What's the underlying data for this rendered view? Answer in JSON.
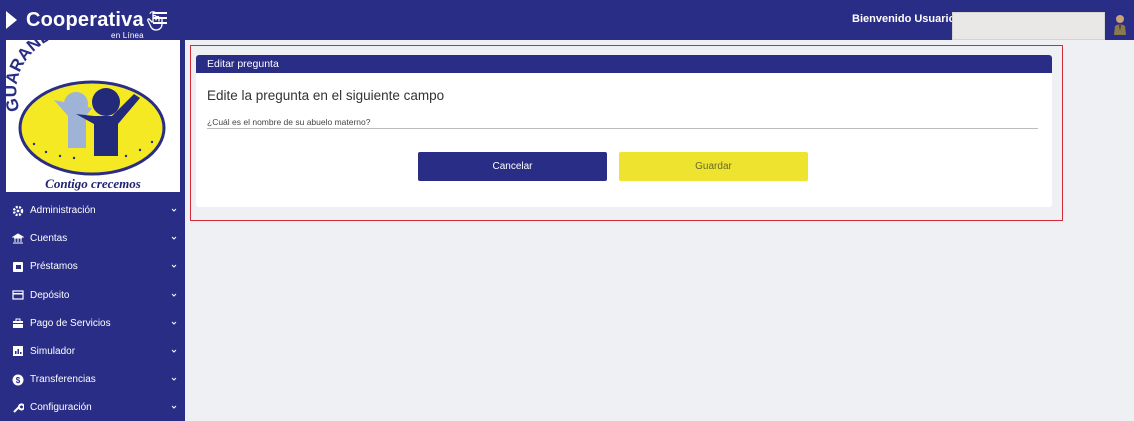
{
  "header": {
    "brand": "Cooperativa",
    "brand_sub": "en Línea",
    "welcome_label": "Bienvenido Usuario:",
    "user_value": ""
  },
  "logo": {
    "name": "GUARANDA Ltda.",
    "slogan": "Contigo crecemos"
  },
  "sidebar": {
    "items": [
      {
        "label": "Administración",
        "icon": "gear-icon"
      },
      {
        "label": "Cuentas",
        "icon": "bank-icon"
      },
      {
        "label": "Préstamos",
        "icon": "wallet-icon"
      },
      {
        "label": "Depósito",
        "icon": "card-icon"
      },
      {
        "label": "Pago de Servicios",
        "icon": "briefcase-icon"
      },
      {
        "label": "Simulador",
        "icon": "chart-icon"
      },
      {
        "label": "Transferencias",
        "icon": "dollar-icon"
      },
      {
        "label": "Configuración",
        "icon": "wrench-icon"
      }
    ]
  },
  "card": {
    "header": "Editar pregunta",
    "title": "Edite la pregunta en el siguiente campo",
    "field_value": "¿Cuál es el nombre de su abuelo materno?",
    "cancel_label": "Cancelar",
    "save_label": "Guardar"
  },
  "colors": {
    "primary": "#2a2d86",
    "accent_yellow": "#eee32e",
    "highlight_border": "#d42a3a",
    "background": "#eef0f3"
  }
}
